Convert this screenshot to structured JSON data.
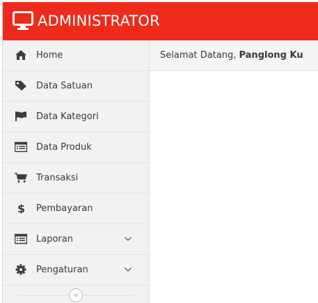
{
  "header": {
    "brand_icon": "monitor-icon",
    "brand_title": "ADMINISTRATOR",
    "color": "#ee2b1b"
  },
  "sidebar": {
    "items": [
      {
        "label": "Home",
        "icon": "home-icon"
      },
      {
        "label": "Data Satuan",
        "icon": "tag-icon"
      },
      {
        "label": "Data Kategori",
        "icon": "flag-icon"
      },
      {
        "label": "Data Produk",
        "icon": "list-icon"
      },
      {
        "label": "Transaksi",
        "icon": "cart-icon"
      },
      {
        "label": "Pembayaran",
        "icon": "dollar-icon"
      },
      {
        "label": "Laporan",
        "icon": "list-icon",
        "expandable": true
      },
      {
        "label": "Pengaturan",
        "icon": "gear-icon",
        "expandable": true
      }
    ],
    "collapse_button": {
      "icon": "double-chevron-left-icon",
      "glyph": "«"
    }
  },
  "content": {
    "welcome_prefix": "Selamat Datang, ",
    "welcome_user": "Panglong Ku"
  }
}
